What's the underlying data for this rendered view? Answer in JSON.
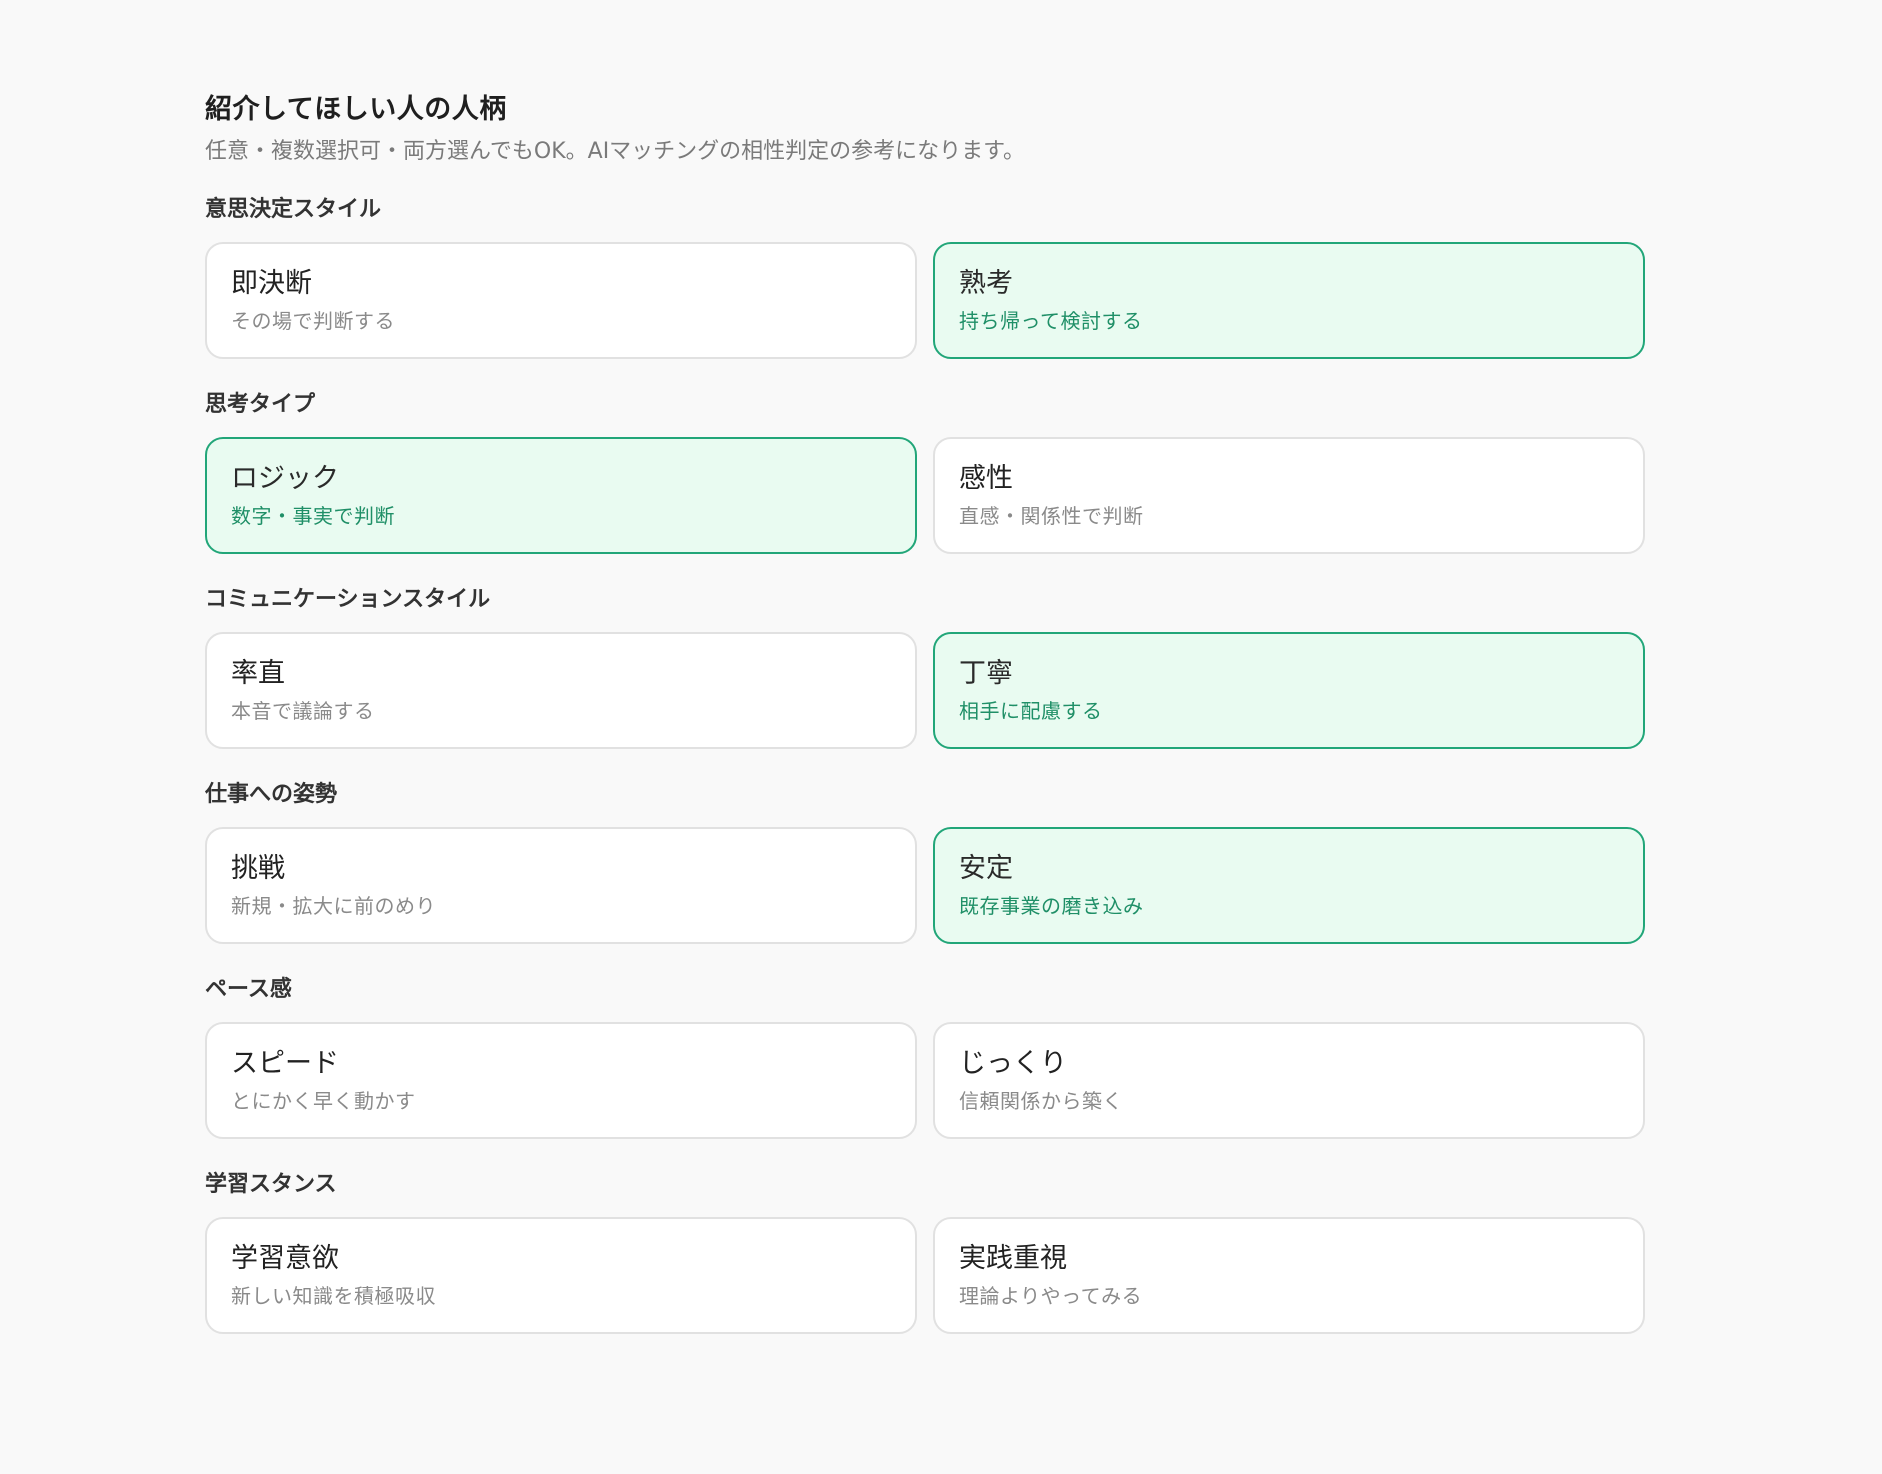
{
  "section": {
    "title": "紹介してほしい人の人柄",
    "description": "任意・複数選択可・両方選んでもOK。AIマッチングの相性判定の参考になります。"
  },
  "colors": {
    "selected_border": "#22a679",
    "selected_background": "#e9fbf1",
    "selected_subtext": "#1f8f67"
  },
  "groups": [
    {
      "label": "意思決定スタイル",
      "options": [
        {
          "title": "即決断",
          "subtitle": "その場で判断する",
          "selected": false
        },
        {
          "title": "熟考",
          "subtitle": "持ち帰って検討する",
          "selected": true
        }
      ]
    },
    {
      "label": "思考タイプ",
      "options": [
        {
          "title": "ロジック",
          "subtitle": "数字・事実で判断",
          "selected": true
        },
        {
          "title": "感性",
          "subtitle": "直感・関係性で判断",
          "selected": false
        }
      ]
    },
    {
      "label": "コミュニケーションスタイル",
      "options": [
        {
          "title": "率直",
          "subtitle": "本音で議論する",
          "selected": false
        },
        {
          "title": "丁寧",
          "subtitle": "相手に配慮する",
          "selected": true
        }
      ]
    },
    {
      "label": "仕事への姿勢",
      "options": [
        {
          "title": "挑戦",
          "subtitle": "新規・拡大に前のめり",
          "selected": false
        },
        {
          "title": "安定",
          "subtitle": "既存事業の磨き込み",
          "selected": true
        }
      ]
    },
    {
      "label": "ペース感",
      "options": [
        {
          "title": "スピード",
          "subtitle": "とにかく早く動かす",
          "selected": false
        },
        {
          "title": "じっくり",
          "subtitle": "信頼関係から築く",
          "selected": false
        }
      ]
    },
    {
      "label": "学習スタンス",
      "options": [
        {
          "title": "学習意欲",
          "subtitle": "新しい知識を積極吸収",
          "selected": false
        },
        {
          "title": "実践重視",
          "subtitle": "理論よりやってみる",
          "selected": false
        }
      ]
    }
  ]
}
